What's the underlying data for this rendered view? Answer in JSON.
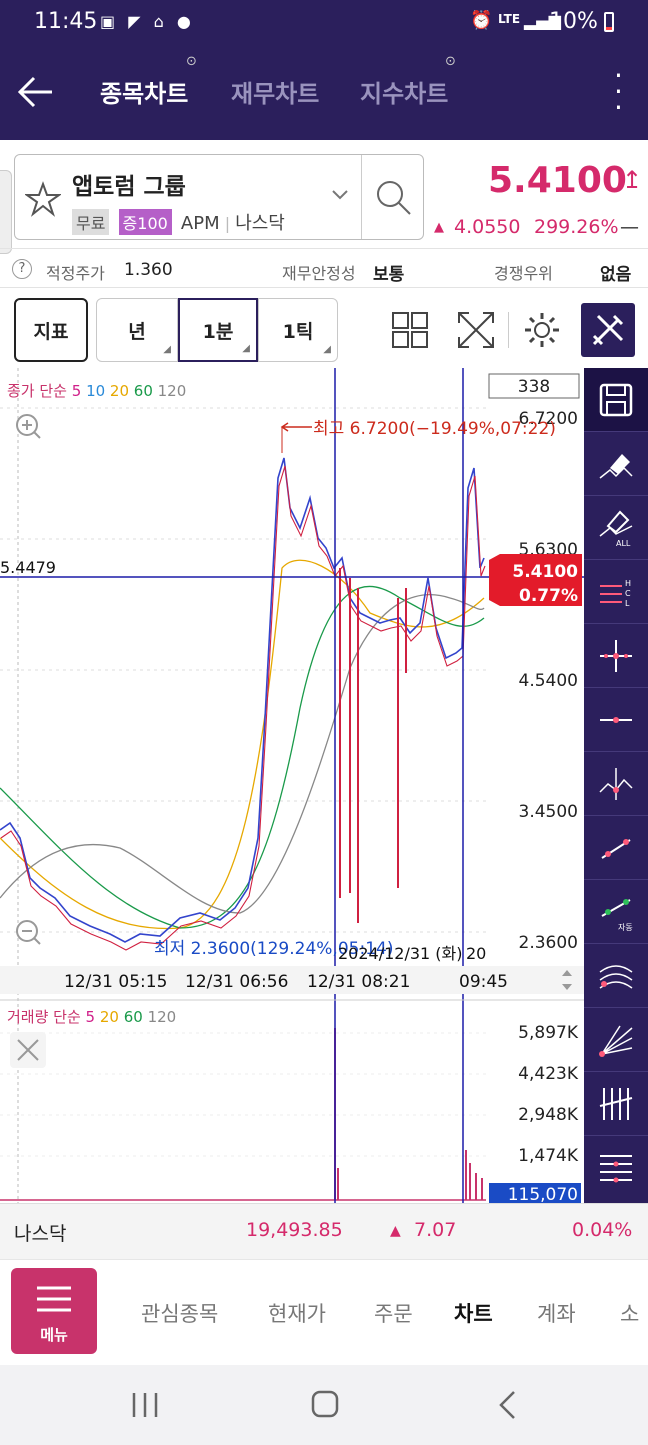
{
  "status": {
    "time": "11:45",
    "lte": "LTE",
    "battery": "10%"
  },
  "header": {
    "tabs": [
      "종목차트",
      "재무차트",
      "지수차트"
    ]
  },
  "stock": {
    "name": "앱토럼 그룹",
    "tags": [
      "무료",
      "증100"
    ],
    "ticker": "APM",
    "market": "나스닥",
    "price": "5.4100",
    "change": "4.0550",
    "change_pct": "299.26%",
    "change_dash": "—"
  },
  "info": {
    "fair_label": "적정주가",
    "fair_value": "1.360",
    "stability_label": "재무안정성",
    "stability_value": "보통",
    "compete_label": "경쟁우위",
    "compete_value": "없음"
  },
  "toolbar": {
    "indicator": "지표",
    "year": "년",
    "min1": "1분",
    "tick1": "1틱"
  },
  "chart": {
    "legend_label": "종가 단순",
    "legend_periods": [
      "5",
      "10",
      "20",
      "60",
      "120"
    ],
    "legend_colors": [
      "#d0208a",
      "#2a8ad8",
      "#e6a800",
      "#1a9a4a",
      "#888888"
    ],
    "count_box": "338",
    "high_label": "최고 6.7200(−19.49%,07:22)",
    "low_label": "최저 2.3600(129.24%,05:14)",
    "cursor_price": "5.4479",
    "current_price": "5.4100",
    "current_pct": "0.77%",
    "date_overlay": "2024/12/31 (화)",
    "date_overlay2": "20",
    "time_labels": [
      "12/31 05:15",
      "12/31 06:56",
      "12/31 08:21",
      "09:45"
    ]
  },
  "chart_data": {
    "type": "line",
    "title": "",
    "y_ticks": [
      "6.7200",
      "5.6300",
      "4.5400",
      "3.4500",
      "2.3600"
    ],
    "ylim": [
      2.36,
      6.72
    ],
    "volume_ticks": [
      "5,897K",
      "4,423K",
      "2,948K",
      "1,474K"
    ],
    "volume_current": "115,070",
    "volume_legend_label": "거래량 단순",
    "volume_legend_periods": [
      "5",
      "20",
      "60",
      "120"
    ]
  },
  "index": {
    "name": "나스닥",
    "value": "19,493.85",
    "change": "7.07",
    "pct": "0.04%"
  },
  "nav": {
    "menu": "메뉴",
    "items": [
      "관심종목",
      "현재가",
      "주문",
      "차트",
      "계좌",
      "소"
    ]
  }
}
